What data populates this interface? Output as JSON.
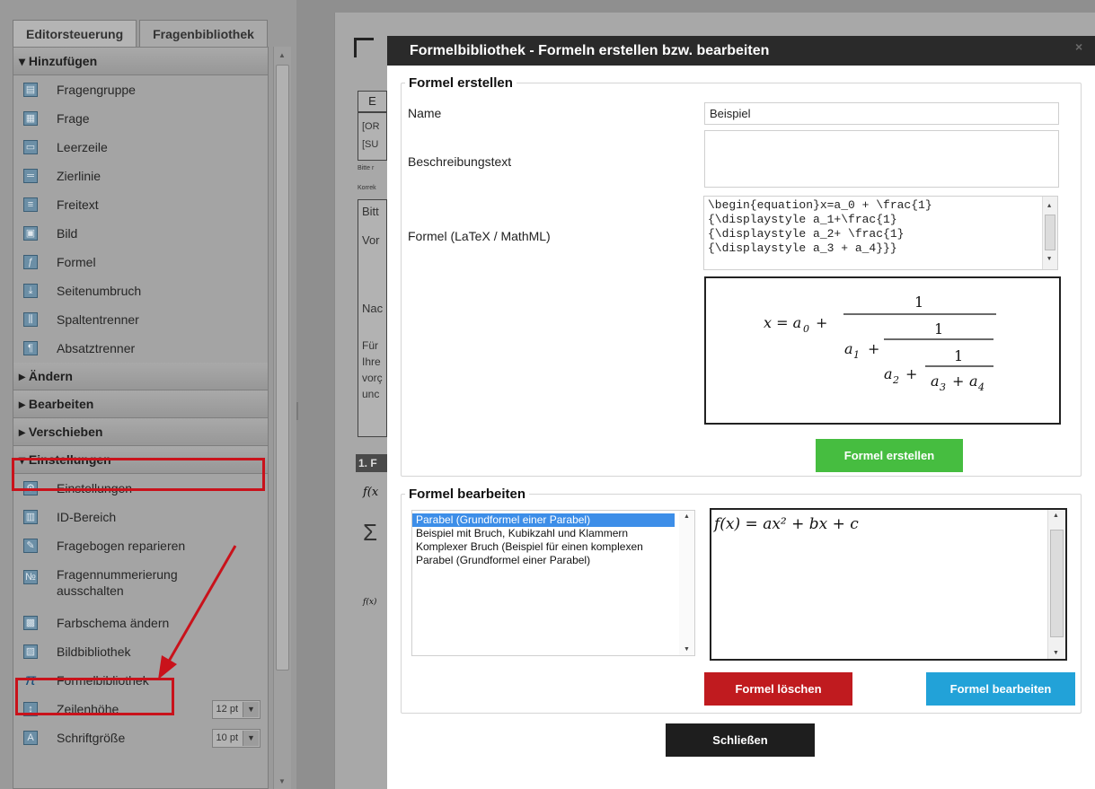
{
  "sidebar": {
    "tabs": [
      "Editorsteuerung",
      "Fragenbibliothek"
    ],
    "sections": {
      "hinzufuegen": "Hinzufügen",
      "aendern": "Ändern",
      "bearbeiten": "Bearbeiten",
      "verschieben": "Verschieben",
      "einstellungen": "Einstellungen"
    },
    "add_items": [
      "Fragengruppe",
      "Frage",
      "Leerzeile",
      "Zierlinie",
      "Freitext",
      "Bild",
      "Formel",
      "Seitenumbruch",
      "Spaltentrenner",
      "Absatztrenner"
    ],
    "settings_items": {
      "einstellungen": "Einstellungen",
      "id_bereich": "ID-Bereich",
      "reparieren": "Fragebogen reparieren",
      "nummerierung_1": "Fragennummerierung",
      "nummerierung_2": "ausschalten",
      "farbschema": "Farbschema ändern",
      "bildbibliothek": "Bildbibliothek",
      "formelbibliothek": "Formelbibliothek",
      "zeilenhoehe": "Zeilenhöhe",
      "zeilenhoehe_value": "12 pt",
      "schriftgroesse": "Schriftgröße",
      "schriftgroesse_value": "10 pt"
    }
  },
  "document": {
    "snippets": [
      "E",
      "[OR",
      "[SU",
      "Bitte r",
      "Korrek",
      "Bitt",
      "Vor",
      "Nac",
      "Für",
      "Ihre",
      "vorç",
      "unc",
      "1. F",
      "f(x",
      "Σ",
      "f(x)"
    ]
  },
  "modal": {
    "title": "Formelbibliothek - Formeln erstellen bzw. bearbeiten",
    "close": "×",
    "create": {
      "legend": "Formel erstellen",
      "name_label": "Name",
      "name_value": "Beispiel",
      "desc_label": "Beschreibungstext",
      "desc_value": "",
      "formula_label": "Formel (LaTeX / MathML)",
      "latex_value": "\\begin{equation}x=a_0 + \\frac{1}\n{\\displaystyle a_1+\\frac{1}\n{\\displaystyle a_2+ \\frac{1}\n{\\displaystyle a_3 + a_4}}}",
      "preview": {
        "lhs": "x = a",
        "sub0": "0",
        "one": "1",
        "a1": "a",
        "sub1": "1",
        "a2": "a",
        "sub2": "2",
        "a3": "a",
        "sub3": "3",
        "a4": "a",
        "sub4": "4",
        "plus": "+"
      },
      "button": "Formel erstellen"
    },
    "edit": {
      "legend": "Formel bearbeiten",
      "list": [
        "Parabel (Grundformel einer Parabel)",
        "Beispiel mit Bruch, Kubikzahl und Klammern",
        "Komplexer Bruch (Beispiel für einen komplexen",
        "Parabel (Grundformel einer Parabel)"
      ],
      "formula_display": "f(x) = ax² + bx + c",
      "delete_button": "Formel löschen",
      "edit_button": "Formel bearbeiten"
    },
    "close_button": "Schließen"
  },
  "colors": {
    "title_bar": "#2a2a2a",
    "create_button": "#46bd40",
    "delete_button": "#c01b1f",
    "edit_button": "#22a2d8",
    "close_button": "#1e1e1e",
    "highlight": "#c9121b",
    "selection": "#3d8ee8"
  }
}
